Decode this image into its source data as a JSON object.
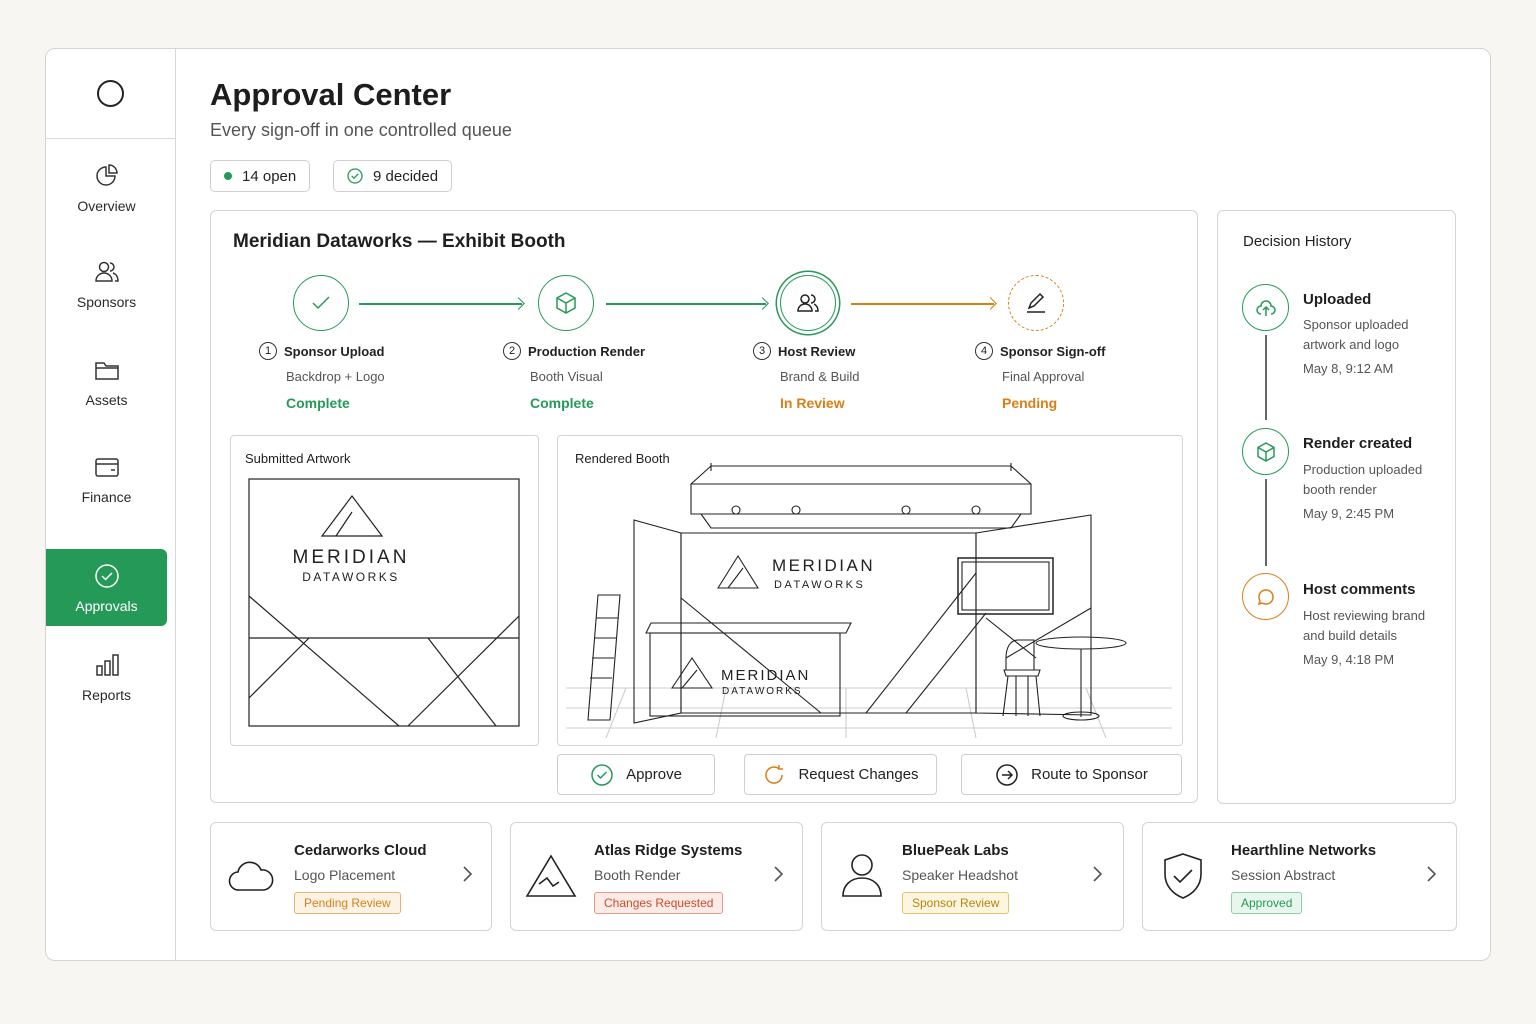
{
  "sidebar": {
    "items": [
      {
        "label": "Overview",
        "icon": "pie-chart-icon"
      },
      {
        "label": "Sponsors",
        "icon": "users-icon"
      },
      {
        "label": "Assets",
        "icon": "folder-icon"
      },
      {
        "label": "Finance",
        "icon": "wallet-icon"
      },
      {
        "label": "Approvals",
        "icon": "check-circle-icon",
        "active": true
      },
      {
        "label": "Reports",
        "icon": "bar-chart-icon"
      }
    ]
  },
  "header": {
    "title": "Approval Center",
    "subtitle": "Every sign-off in one controlled queue",
    "open_count": "14 open",
    "decided_count": "9 decided"
  },
  "workflow": {
    "title": "Meridian Dataworks — Exhibit Booth",
    "steps": [
      {
        "num": "1",
        "label": "Sponsor Upload",
        "sub": "Backdrop + Logo",
        "status": "Complete",
        "status_color": "#259a58",
        "icon": "check-icon"
      },
      {
        "num": "2",
        "label": "Production Render",
        "sub": "Booth Visual",
        "status": "Complete",
        "status_color": "#259a58",
        "icon": "cube-icon"
      },
      {
        "num": "3",
        "label": "Host Review",
        "sub": "Brand & Build",
        "status": "In Review",
        "status_color": "#d97f16",
        "icon": "users-icon"
      },
      {
        "num": "4",
        "label": "Sponsor Sign-off",
        "sub": "Final Approval",
        "status": "Pending",
        "status_color": "#d97f16",
        "icon": "pen-icon"
      }
    ],
    "artwork_title": "Submitted Artwork",
    "booth_title": "Rendered Booth",
    "brand_line1": "MERIDIAN",
    "brand_line2": "DATAWORKS",
    "actions": {
      "approve": "Approve",
      "request_changes": "Request Changes",
      "route": "Route to Sponsor"
    }
  },
  "history": {
    "title": "Decision History",
    "events": [
      {
        "title": "Uploaded",
        "desc": "Sponsor uploaded artwork and logo",
        "time": "May 8, 9:12 AM",
        "icon": "cloud-upload-icon",
        "color": "#259a58"
      },
      {
        "title": "Render created",
        "desc": "Production uploaded booth render",
        "time": "May 9, 2:45 PM",
        "icon": "cube-icon",
        "color": "#259a58"
      },
      {
        "title": "Host comments",
        "desc": "Host reviewing brand and build details",
        "time": "May 9, 4:18 PM",
        "icon": "chat-icon",
        "color": "#d97f16"
      }
    ]
  },
  "queue": [
    {
      "name": "Cedarworks Cloud",
      "desc": "Logo Placement",
      "badge": "Pending Review",
      "badge_color": "#d97f16",
      "icon": "cloud-icon"
    },
    {
      "name": "Atlas Ridge Systems",
      "desc": "Booth Render",
      "badge": "Changes Requested",
      "badge_color": "#cc4b2c",
      "icon": "mountain-icon"
    },
    {
      "name": "BluePeak Labs",
      "desc": "Speaker Headshot",
      "badge": "Sponsor Review",
      "badge_color": "#b8860b",
      "icon": "person-icon"
    },
    {
      "name": "Hearthline Networks",
      "desc": "Session Abstract",
      "badge": "Approved",
      "badge_color": "#259a58",
      "icon": "shield-check-icon"
    }
  ]
}
